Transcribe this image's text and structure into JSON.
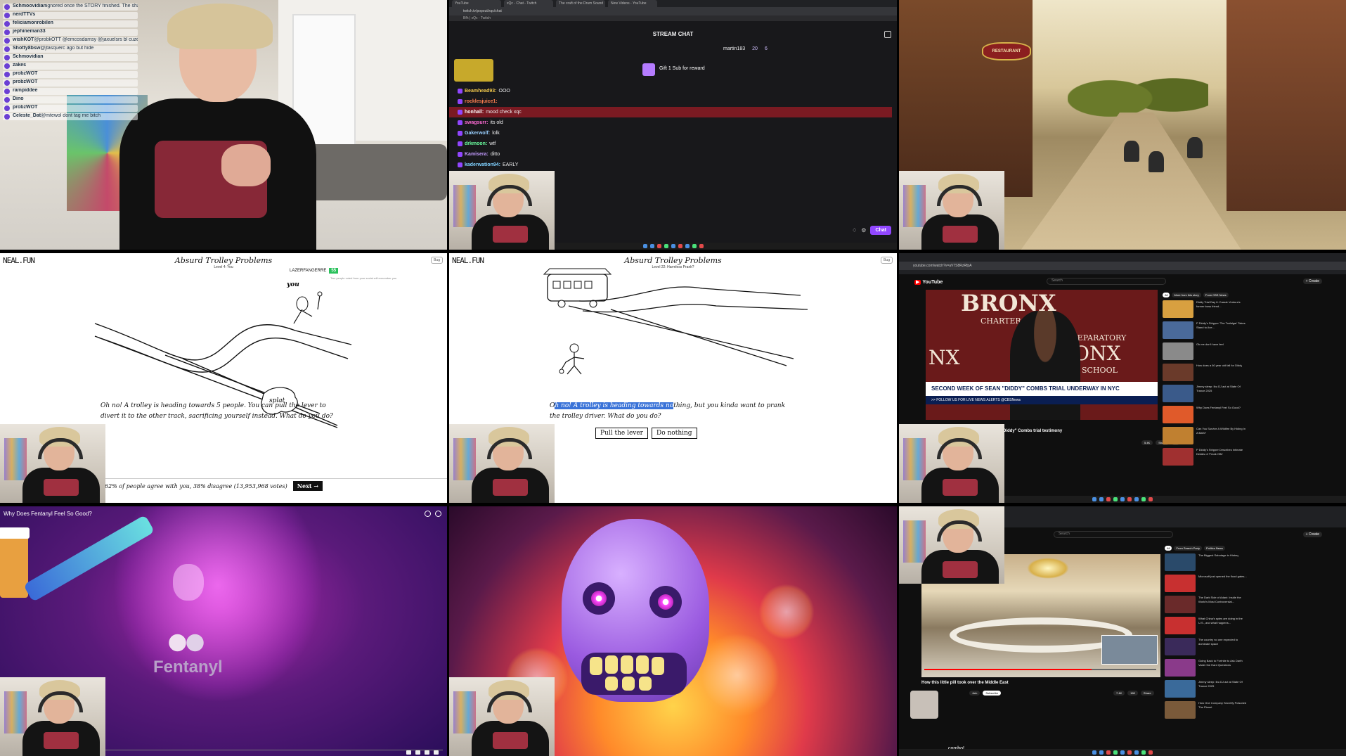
{
  "cell1": {
    "chat_overlay": [
      {
        "user": "Schmoovidian",
        "text": "ignored once the STORY finished. The shack skies"
      },
      {
        "user": "nerdTTVs",
        "text": ""
      },
      {
        "user": "feliciamonrobilen",
        "text": ""
      },
      {
        "user": "jephineman33",
        "text": ""
      },
      {
        "user": "wishKOT",
        "text": "@probkOTT @emcosdamsy @jaxuelsrs bl cuzemis"
      },
      {
        "user": "Shotty8bsw",
        "text": "@jtasquerc ago but hide"
      },
      {
        "user": "Schmovidian",
        "text": ""
      },
      {
        "user": "zakes",
        "text": ""
      },
      {
        "user": "probzWOT",
        "text": ""
      },
      {
        "user": "probzWOT",
        "text": ""
      },
      {
        "user": "rampiddee",
        "text": ""
      },
      {
        "user": "Dino",
        "text": ""
      },
      {
        "user": "probzWOT",
        "text": ""
      },
      {
        "user": "Celeste_Dat",
        "text": "@mtewol dont tag me bitch"
      }
    ]
  },
  "cell2": {
    "tabs": [
      "YouTube",
      "xQc - Chat - Twitch",
      "The craft of the Drum Sound",
      "New Videos - YouTube"
    ],
    "url": "twitch.tv/popout/xqc/chat",
    "bookmark": "Bfh | xQc - Twitch",
    "title": "STREAM CHAT",
    "top_user": "martin183",
    "top_count_a": "20",
    "top_count_b": "6",
    "gift_text": "Gift 1 Sub for reward",
    "messages": [
      {
        "user": "Beamhead93:",
        "text": "OOO",
        "color": "#f2c94c"
      },
      {
        "user": "rocklesjuice1:",
        "text": "",
        "color": "#ff7f50"
      },
      {
        "user": "honhall:",
        "text": "mood check xqc",
        "color": "#fff",
        "highlight": true
      },
      {
        "user": "swagsurr:",
        "text": "its old",
        "color": "#ff6bd6"
      },
      {
        "user": "Gakerwolf:",
        "text": "lolk",
        "color": "#9ad0ff"
      },
      {
        "user": "drkmoon:",
        "text": "wtf",
        "color": "#6bffa0"
      },
      {
        "user": "Kamisera:",
        "text": "ditto",
        "color": "#c39bff"
      },
      {
        "user": "kaderwation94:",
        "text": "EARLY",
        "color": "#7fd0ff"
      }
    ],
    "chat_button": "Chat"
  },
  "cell3": {
    "sign_text": "RESTAURANT"
  },
  "trolley1": {
    "logo": "NEAL.FUN",
    "title": "Absurd Trolley Problems",
    "level": "Level 4: You",
    "bug": "Bug",
    "user": "LAZERFANGERRE",
    "user_score": "55",
    "user_sub": "Two people voted from your social will remember you",
    "label_you": "you",
    "label_splat": "splat",
    "question": "Oh no! A trolley is heading towards 5 people. You can pull the lever to divert it to the other track, sacrificing yourself instead. What do you do?",
    "stats": "62% of people agree with you, 38% disagree (13,953,968 votes)",
    "next": "Next →"
  },
  "trolley2": {
    "logo": "NEAL.FUN",
    "title": "Absurd Trolley Problems",
    "level": "Level 22: Harmless Prank?",
    "bug": "Bug",
    "question_pre": "O",
    "question_hl": "h no! A trolley is heading towards no",
    "question_post": "thing, but you kinda want to prank the trolley driver. What do you do?",
    "btn_pull": "Pull the lever",
    "btn_nothing": "Do nothing"
  },
  "yt1": {
    "logo": "YouTube",
    "search": "Search",
    "create": "+ Create",
    "url": "youtube.com/watch?v=aV7S8RzRfpA",
    "banner_words": [
      "BRONX",
      "CHARTER SCHOOL",
      "PREPARATORY",
      "NX",
      "ONX",
      "SCHOOL"
    ],
    "chyron": "SECOND WEEK OF SEAN \"DIDDY\" COMBS TRIAL UNDERWAY IN NYC",
    "chyron_sub": ">> FOLLOW US FOR LIVE NEWS ALERTS @CBSNews",
    "video_title": "Diddy\" Combs trial testimony",
    "chips": [
      "All",
      "More from this story",
      "From CBS News"
    ],
    "recs": [
      "Diddy Trial Day 6: Cassie Ventura's former boss friend...",
      "P Diddy's Stripper 'The Trafalgar' Takes Stand to Ave...",
      "Ok me don't have feel",
      "How does a 60 year old fall for Diddy",
      "Jimmy sleep: Ibu DJ act at State Of Trance 2025",
      "Why Does Fentanyl Feel So Good?",
      "Can You Survive A Wildfire By Hiding In A Bath?",
      "P Diddy's Stripper Describes Intimate Details of 'Freak Offs'"
    ],
    "actions": [
      "5.4K",
      "Share",
      "..."
    ]
  },
  "fentanyl": {
    "title": "Why Does Fentanyl Feel So Good?",
    "word": "Fentanyl"
  },
  "yt2": {
    "search": "Search",
    "create": "+ Create",
    "video_title": "How this little pill took over the Middle East",
    "chips": [
      "All",
      "From Search Party",
      "Politics News"
    ],
    "recs": [
      "The Biggest Sabotage in History",
      "Microsoft just opened the flood gates...",
      "The Dark Side of Adani: Inside the World's Most Controversial...",
      "What China's spies are doing in the U.S., and what happens...",
      "The country no one expected to dominate space",
      "Going Back to Fortnite to Ask Darth Vader the Hard Questions",
      "Jimmy sleep: Ibu DJ act at State Of Trance 2025",
      "How One Company Secretly Poisoned The Planet"
    ],
    "subscribe": "Subscribe",
    "join": "Join",
    "combo": "combo!",
    "actions": [
      "7.4K",
      "160",
      "Share"
    ]
  }
}
